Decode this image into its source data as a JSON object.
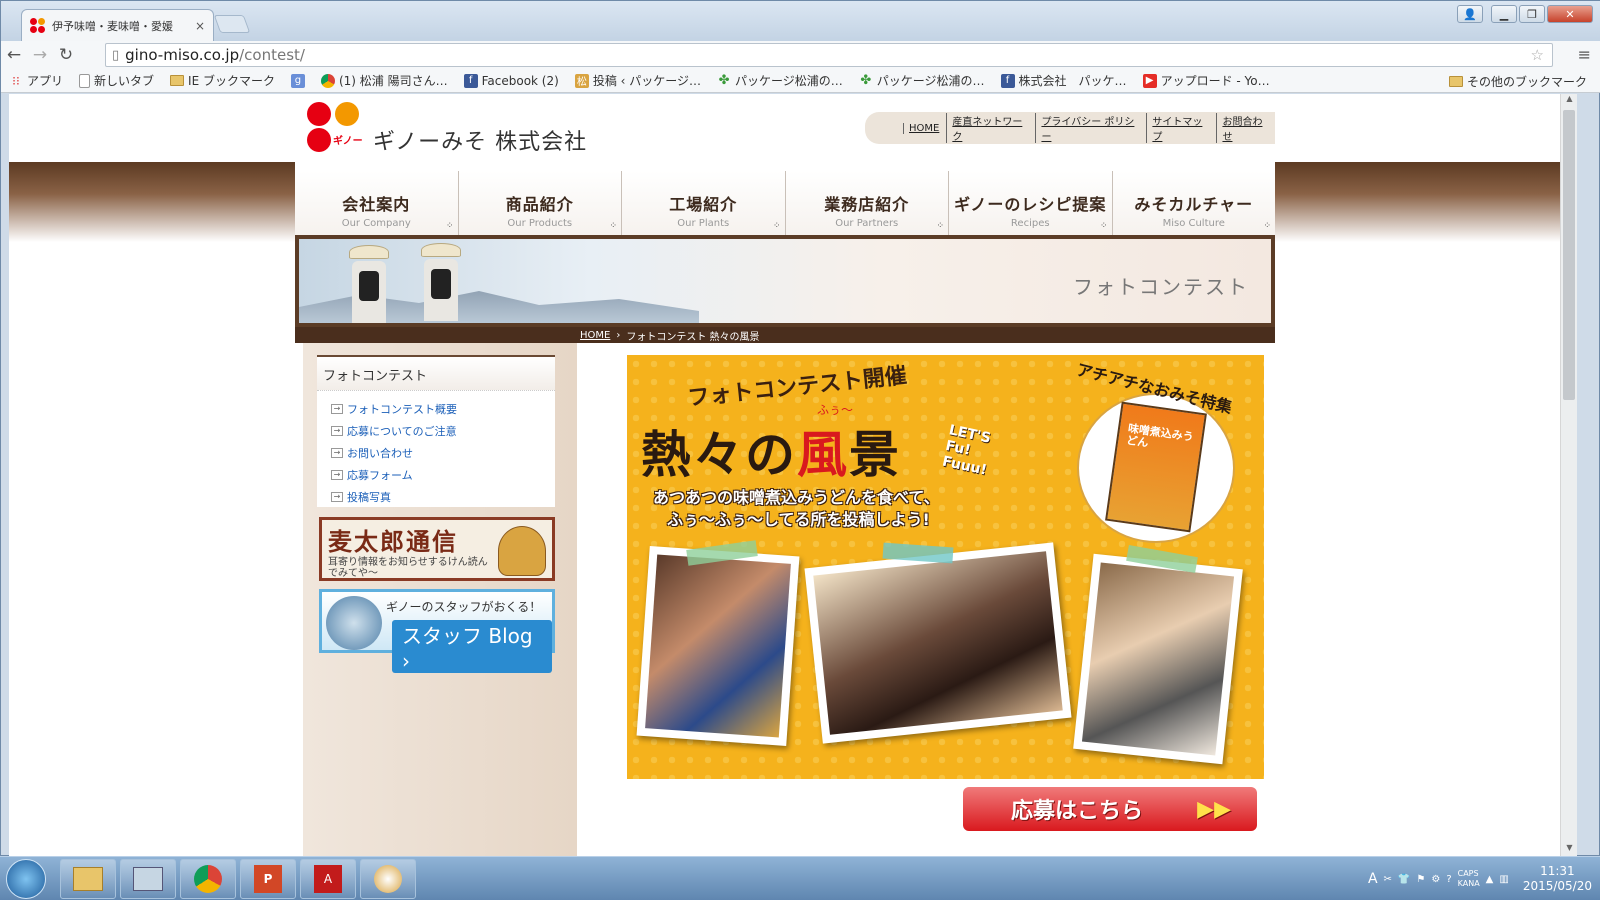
{
  "browser": {
    "tab_title": "伊予味噌・麦味噌・愛媛",
    "tab_close": "×",
    "url_host": "gino-miso.co.jp",
    "url_path": "/contest/",
    "bookmarks": [
      {
        "label": "アプリ",
        "icon": "apps-grid-icon"
      },
      {
        "label": "新しいタブ",
        "icon": "page-icon"
      },
      {
        "label": "IE ブックマーク",
        "icon": "folder-icon"
      },
      {
        "label": "",
        "icon": "google-g-icon"
      },
      {
        "label": "(1) 松浦 陽司さん…",
        "icon": "chrome-icon"
      },
      {
        "label": "Facebook (2)",
        "icon": "facebook-icon"
      },
      {
        "label": "投稿 ‹ パッケージ…",
        "icon": "site-icon"
      },
      {
        "label": "パッケージ松浦の…",
        "icon": "clover-icon"
      },
      {
        "label": "パッケージ松浦の…",
        "icon": "clover-icon"
      },
      {
        "label": "株式会社　パッケ…",
        "icon": "facebook-icon"
      },
      {
        "label": "アップロード - Yo…",
        "icon": "youtube-icon"
      }
    ],
    "other_bookmarks": "その他のブックマーク"
  },
  "site": {
    "company": "ギノーみそ 株式会社",
    "logo_text": "ギノー",
    "utility_links": [
      "HOME",
      "産直ネットワーク",
      "プライバシー ポリシー",
      "サイトマップ",
      "お問合わせ"
    ],
    "nav": [
      {
        "jp": "会社案内",
        "en": "Our Company"
      },
      {
        "jp": "商品紹介",
        "en": "Our Products"
      },
      {
        "jp": "工場紹介",
        "en": "Our Plants"
      },
      {
        "jp": "業務店紹介",
        "en": "Our Partners"
      },
      {
        "jp": "ギノーのレシピ提案",
        "en": "Recipes"
      },
      {
        "jp": "みそカルチャー",
        "en": "Miso Culture"
      }
    ],
    "banner_title": "フォトコンテスト",
    "breadcrumb": {
      "home": "HOME",
      "sep": "›",
      "current": "フォトコンテスト 熱々の風景"
    }
  },
  "sidebar": {
    "heading": "フォトコンテスト",
    "items": [
      "フォトコンテスト概要",
      "応募についてのご注意",
      "お問い合わせ",
      "応募フォーム",
      "投稿写真"
    ],
    "mugi": {
      "title": "麦太郎通信",
      "text": "耳寄り情報をお知らせするけん読んでみてや〜"
    },
    "blog": {
      "line1": "ギノーのスタッフがおくる！",
      "line2": "スタッフ Blog ›"
    }
  },
  "poster": {
    "subtitle": "フォトコンテスト開催",
    "title_a": "熱々の",
    "title_b": "風",
    "title_c": "景",
    "furigana": "ふぅ〜",
    "lets": "LET'S Fu! Fuuu!",
    "desc1": "あつあつの味噌煮込みうどんを食べて、",
    "desc2": "ふぅ〜ふぅ〜してる所を投稿しよう!",
    "feature": "アチアチなおみそ特集",
    "package_text": "味噌煮込みうどん"
  },
  "apply_button": {
    "label": "応募はこちら",
    "arrows": "▶▶"
  },
  "taskbar": {
    "time": "11:31",
    "date": "2015/05/20",
    "caps": "CAPS",
    "kana": "KANA"
  }
}
